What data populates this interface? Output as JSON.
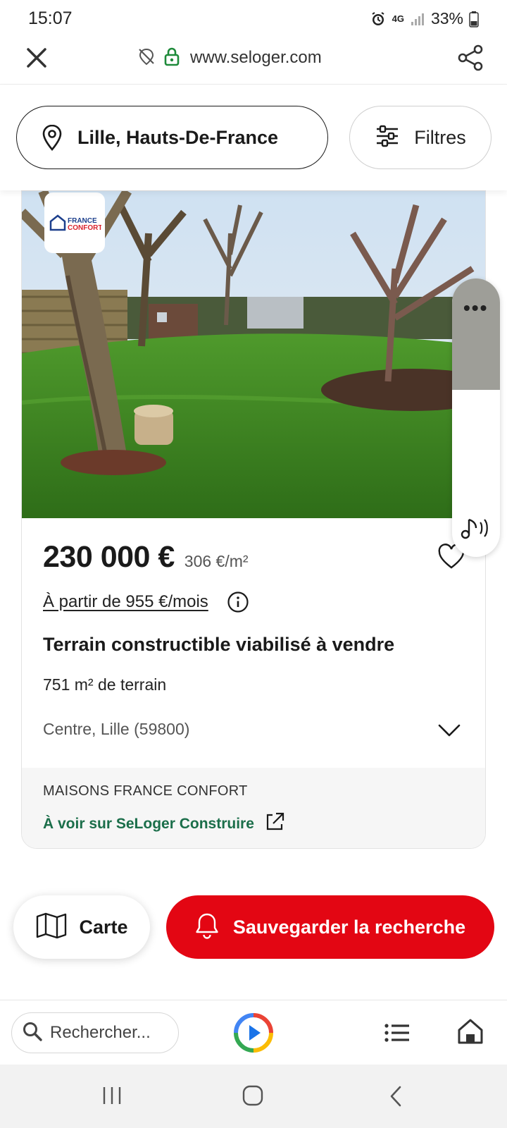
{
  "status_bar": {
    "time": "15:07",
    "network": "4G",
    "battery": "33%"
  },
  "browser": {
    "url": "www.seloger.com"
  },
  "search": {
    "location": "Lille, Hauts-De-France",
    "filters_label": "Filtres"
  },
  "listing": {
    "agency_logo_text": "FRANCE CONFORT",
    "price": "230 000 €",
    "price_per_m2": "306 €/m²",
    "monthly": "À partir de 955 €/mois",
    "title": "Terrain constructible viabilisé à vendre",
    "surface": "751 m² de terrain",
    "address": "Centre, Lille (59800)",
    "agency_name": "MAISONS FRANCE CONFORT",
    "agency_link": "À voir sur SeLoger Construire"
  },
  "side_panel": {
    "more_label": "•••"
  },
  "actions": {
    "map_label": "Carte",
    "save_label": "Sauvegarder la recherche"
  },
  "bottom_toolbar": {
    "search_placeholder": "Rechercher..."
  },
  "colors": {
    "brand_red": "#e30613",
    "link_green": "#1b6e4a",
    "text_dark": "#1a1a1a"
  },
  "icons": [
    "alarm-icon",
    "signal-icon",
    "battery-icon",
    "close-icon",
    "tracking-blocked-icon",
    "lock-icon",
    "share-icon",
    "location-pin-icon",
    "filters-icon",
    "heart-icon",
    "info-icon",
    "chevron-down-icon",
    "external-link-icon",
    "more-icon",
    "audio-icon",
    "map-icon",
    "bell-icon",
    "search-icon",
    "assistant-play-icon",
    "menu-icon",
    "home-icon",
    "recent-apps-icon",
    "android-home-icon",
    "back-icon"
  ]
}
